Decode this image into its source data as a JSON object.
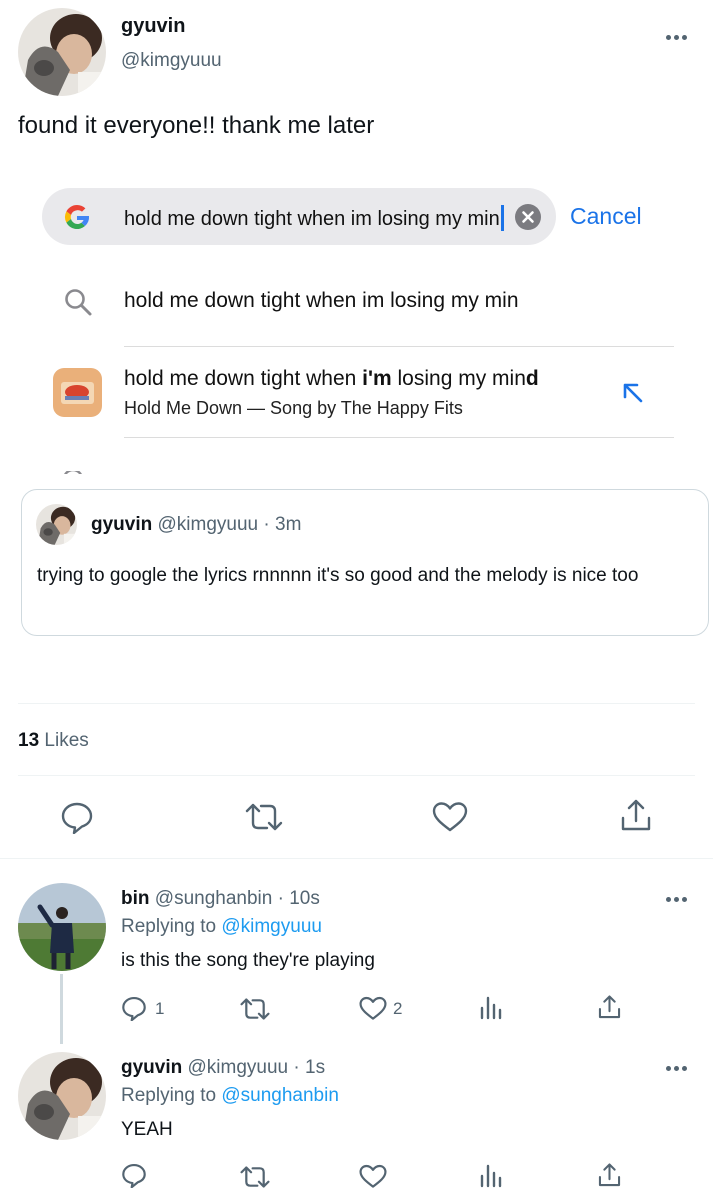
{
  "tweet": {
    "author_name": "gyuvin",
    "author_handle": "@kimgyuuu",
    "text": "found it everyone!! thank me later",
    "likes_count": "13",
    "likes_label": "Likes"
  },
  "embedded_search": {
    "query": "hold me down tight when im losing my min",
    "cancel_label": "Cancel",
    "suggestion_1": "hold me down tight when im losing my min",
    "suggestion_2_prefix": "hold me down tight when ",
    "suggestion_2_bold_1": "i'm",
    "suggestion_2_mid": " losing my min",
    "suggestion_2_bold_2": "d",
    "suggestion_2_subtitle": "Hold Me Down — Song by The Happy Fits",
    "icons": [
      "google-logo",
      "clear-icon",
      "search-icon",
      "music-app-icon",
      "arrow-up-left-icon"
    ]
  },
  "quoted_tweet": {
    "author_name": "gyuvin",
    "author_handle": "@kimgyuuu",
    "separator": "·",
    "time": "3m",
    "text": "trying to google the lyrics rnnnnn it's so good and the melody is nice too"
  },
  "replies": [
    {
      "author_name": "bin",
      "author_handle": "@sunghanbin",
      "separator": "·",
      "time": "10s",
      "replying_label": "Replying to",
      "replying_to": "@kimgyuuu",
      "text": "is this the song they're playing",
      "reply_count": "1",
      "like_count": "2"
    },
    {
      "author_name": "gyuvin",
      "author_handle": "@kimgyuuu",
      "separator": "·",
      "time": "1s",
      "replying_label": "Replying to",
      "replying_to": "@sunghanbin",
      "text": "YEAH"
    }
  ],
  "colors": {
    "link": "#1d9bf0",
    "muted": "#536471",
    "google_blue": "#1a73e8"
  }
}
